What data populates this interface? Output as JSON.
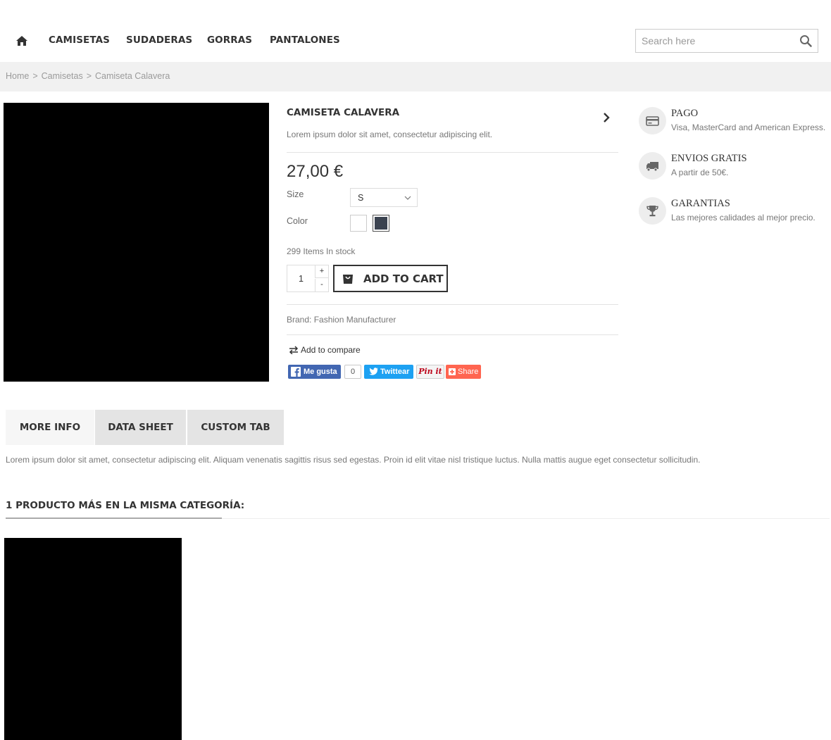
{
  "nav": {
    "home_icon": "home-icon",
    "items": [
      "CAMISETAS",
      "SUDADERAS",
      "GORRAS",
      "PANTALONES"
    ],
    "search_placeholder": "Search here",
    "search_icon": "search-icon"
  },
  "breadcrumb": {
    "items": [
      "Home",
      "Camisetas",
      "Camiseta Calavera"
    ],
    "separator": ">"
  },
  "product": {
    "title": "CAMISETA CALAVERA",
    "short_description": "Lorem ipsum dolor sit amet, consectetur adipiscing elit.",
    "price": "27,00 €",
    "size_label": "Size",
    "size_value": "S",
    "color_label": "Color",
    "colors": [
      "#ffffff",
      "#3b4350"
    ],
    "stock": "299 Items In stock",
    "quantity": "1",
    "qty_up": "+",
    "qty_down": "-",
    "add_to_cart": "ADD TO CART",
    "brand": "Brand: Fashion Manufacturer",
    "compare": "Add to compare"
  },
  "social": {
    "facebook": "Me gusta",
    "facebook_count": "0",
    "twitter": "Twittear",
    "pinterest": "Pin it",
    "share": "Share"
  },
  "info": [
    {
      "icon": "credit-card-icon",
      "title": "PAGO",
      "text": "Visa, MasterCard and American Express."
    },
    {
      "icon": "truck-icon",
      "title": "ENVIOS GRATIS",
      "text": "A partir de 50€."
    },
    {
      "icon": "trophy-icon",
      "title": "GARANTIAS",
      "text": "Las mejores calidades al mejor precio."
    }
  ],
  "tabs": {
    "items": [
      "MORE INFO",
      "DATA SHEET",
      "CUSTOM TAB"
    ],
    "content": "Lorem ipsum dolor sit amet, consectetur adipiscing elit. Aliquam venenatis sagittis risus sed egestas. Proin id elit vitae nisl tristique luctus. Nulla mattis augue eget consectetur sollicitudin."
  },
  "related": {
    "title": "1 PRODUCTO MÁS EN LA MISMA CATEGORÍA:"
  },
  "colors": {
    "breadcrumb_bg": "#f1f1f1",
    "facebook": "#4267b2",
    "twitter": "#1da1f2",
    "share": "#ff6550"
  }
}
